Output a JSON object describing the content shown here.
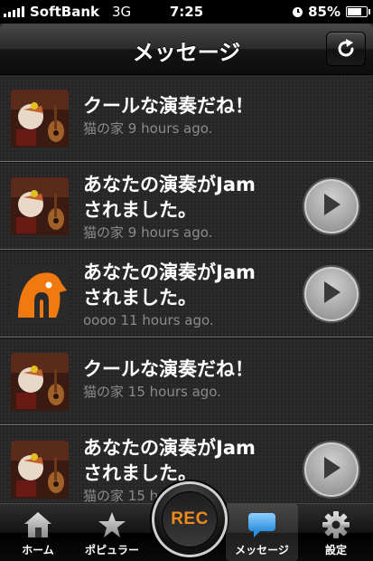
{
  "status_bar": {
    "carrier": "SoftBank",
    "network": "3G",
    "time": "7:25",
    "battery": "85%",
    "battery_level": 0.85
  },
  "nav": {
    "title": "メッセージ",
    "refresh_icon": "refresh-icon"
  },
  "messages": [
    {
      "avatar": "guitar-photo",
      "text": "クールな演奏だね！",
      "sender": "猫の家",
      "time_ago": "9 hours ago.",
      "has_play": false
    },
    {
      "avatar": "guitar-photo",
      "text": "あなたの演奏がJam\nされました。",
      "sender": "猫の家",
      "time_ago": "9 hours ago.",
      "has_play": true
    },
    {
      "avatar": "orange-bird-logo",
      "text": "あなたの演奏がJam\nされました。",
      "sender": "oooo",
      "time_ago": "11 hours ago.",
      "has_play": true
    },
    {
      "avatar": "guitar-photo",
      "text": "クールな演奏だね！",
      "sender": "猫の家",
      "time_ago": "15 hours ago.",
      "has_play": false
    },
    {
      "avatar": "guitar-photo",
      "text": "あなたの演奏がJam\nされました。",
      "sender": "猫の家",
      "time_ago": "15 hours ago.",
      "has_play": true
    }
  ],
  "tabs": [
    {
      "label": "ホーム",
      "icon": "home-icon",
      "active": false
    },
    {
      "label": "ポピュラー",
      "icon": "star-icon",
      "active": false
    },
    {
      "label": "メッセージ",
      "icon": "speech-bubble-icon",
      "active": true
    },
    {
      "label": "設定",
      "icon": "gear-icon",
      "active": false
    }
  ],
  "rec_button": {
    "label": "REC"
  },
  "colors": {
    "accent": "#f08a1c",
    "active_tab_icon": "#3aa0e8"
  }
}
